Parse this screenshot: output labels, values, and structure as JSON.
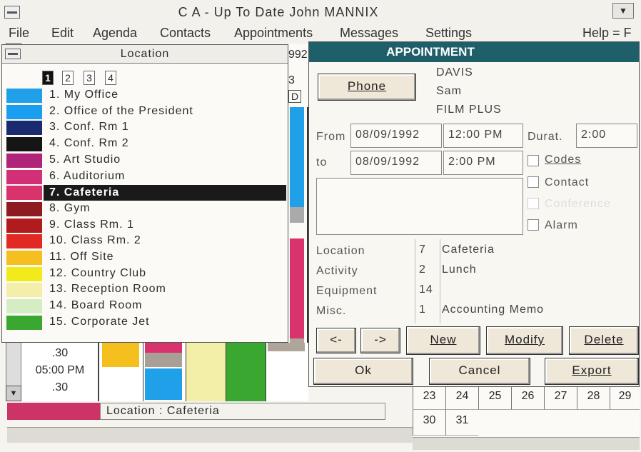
{
  "window": {
    "title": "C A - Up To Date  John MANNIX",
    "max_icon": "▼"
  },
  "menu": {
    "items": [
      "File",
      "Edit",
      "Agenda",
      "Contacts",
      "Appointments",
      "Messages",
      "Settings",
      "Help = F"
    ]
  },
  "location_window": {
    "title": "Location",
    "pages": [
      "1",
      "2",
      "3",
      "4"
    ],
    "active_page": "1",
    "items": [
      {
        "label": "1. My Office",
        "color": "#1fa0e8"
      },
      {
        "label": "2. Office of the President",
        "color": "#1a9ef0"
      },
      {
        "label": "3. Conf. Rm 1",
        "color": "#1a2a6e"
      },
      {
        "label": "4. Conf. Rm 2",
        "color": "#151515"
      },
      {
        "label": "5. Art Studio",
        "color": "#b0257a"
      },
      {
        "label": "6. Auditorium",
        "color": "#d12f78"
      },
      {
        "label": "7. Cafeteria",
        "color": "#d8336c"
      },
      {
        "label": "8. Gym",
        "color": "#8e1a22"
      },
      {
        "label": "9. Class Rm. 1",
        "color": "#b21b1e"
      },
      {
        "label": "10. Class Rm. 2",
        "color": "#e22a24"
      },
      {
        "label": "11. Off Site",
        "color": "#f5bf1e"
      },
      {
        "label": "12. Country Club",
        "color": "#f2ea1a"
      },
      {
        "label": "13. Reception Room",
        "color": "#f3efa8"
      },
      {
        "label": "14. Board Room",
        "color": "#d6ecc2"
      },
      {
        "label": "15. Corporate Jet",
        "color": "#3aa830"
      }
    ],
    "selected": "7. Cafeteria"
  },
  "calendar": {
    "header_fragment": "992",
    "col_letters": [
      "3",
      "D"
    ],
    "times": [
      ".30",
      "05:00 PM",
      ".30"
    ],
    "status_text": "Location : Cafeteria",
    "month_row1": [
      "23",
      "24",
      "25",
      "26",
      "27",
      "28",
      "29"
    ],
    "month_row2": [
      "30",
      "31"
    ]
  },
  "appointment": {
    "title": "APPOINTMENT",
    "phone_label": "Phone",
    "contact": {
      "last": "DAVIS",
      "first": "Sam",
      "company": "FILM PLUS"
    },
    "from_label": "From",
    "to_label": "to",
    "from_date": "08/09/1992",
    "from_time": "12:00 PM",
    "to_date": "08/09/1992",
    "to_time": "2:00 PM",
    "duration_label": "Durat.",
    "duration": "2:00",
    "checkboxes": [
      "Codes",
      "Contact",
      "Conference",
      "Alarm"
    ],
    "fields": [
      {
        "label": "Location",
        "code": "7",
        "value": "Cafeteria"
      },
      {
        "label": "Activity",
        "code": "2",
        "value": "Lunch"
      },
      {
        "label": "Equipment",
        "code": "14",
        "value": ""
      },
      {
        "label": "Misc.",
        "code": "1",
        "value": "Accounting Memo"
      }
    ],
    "buttons": {
      "prev": "<-",
      "next": "->",
      "new": "New",
      "modify": "Modify",
      "delete": "Delete",
      "ok": "Ok",
      "cancel": "Cancel",
      "export": "Export"
    }
  }
}
